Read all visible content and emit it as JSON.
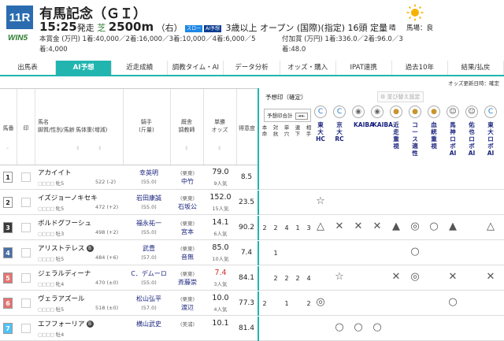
{
  "race": {
    "number": "11R",
    "name": "有馬記念（ＧＩ）",
    "win5": "WIN5",
    "start_time": "15:25",
    "start_suffix": "発走",
    "surface": "芝",
    "distance": "2500m",
    "direction": "（右）",
    "badge_slow": "スロー",
    "badge_yoso": "AI予想",
    "condition": "3歳以上 オープン (国際)(指定) 16頭 定量",
    "prize_line1": "本賞金 (万円) 1着:40,000／2着:16,000／3着:10,000／4着:6,000／5",
    "prize_line2": "着:4,000",
    "add_prize_line1": "付加賞 (万円) 1着:336.0／2着:96.0／3",
    "add_prize_line2": "着:48.0",
    "weather": "晴",
    "track_label": "馬場：良"
  },
  "tabs": [
    {
      "label": "出馬表",
      "active": false
    },
    {
      "label": "AI予想",
      "active": true
    },
    {
      "label": "近走成績",
      "active": false
    },
    {
      "label": "調教タイム・AI",
      "active": false
    },
    {
      "label": "データ分析",
      "active": false
    },
    {
      "label": "オッズ・購入",
      "active": false
    },
    {
      "label": "IPAT連携",
      "active": false
    },
    {
      "label": "過去10年",
      "active": false
    },
    {
      "label": "結果/払戻",
      "active": false
    }
  ],
  "update_note": "オッズ更新日時：確定",
  "columns": {
    "umaban": "馬番",
    "mark": "印",
    "horse": "馬名",
    "horse_sub": "脚質/性別/馬齢",
    "weight": "馬体重(増減)",
    "jockey": "騎手",
    "jockey_sub": "(斤量)",
    "stable": "厩舎",
    "stable_sub": "調教師",
    "odds": "単勝",
    "odds_sub": "オッズ",
    "tokui": "得意度"
  },
  "yosou": {
    "title": "予想印（確定）",
    "sort_label": "並び替え設定",
    "gokei_label": "予想印合計",
    "count_headers": [
      "本命",
      "対抗",
      "単穴",
      "連下",
      "相手"
    ],
    "predictors": [
      "東大HC",
      "京大RC",
      "KAIBA",
      "KAIBA",
      "近走重視",
      "コース適性",
      "血統重視",
      "馬神ロボAI",
      "佑也ロボAI",
      "東大ロボAI"
    ],
    "predictor_icons": [
      "c-icon",
      "c-icon",
      "robot-icon",
      "robot-icon",
      "medal-icon",
      "medal-icon",
      "medal-icon",
      "avatar-icon",
      "avatar-icon",
      "c-icon"
    ]
  },
  "horses": [
    {
      "waku": "1",
      "umaban": "1",
      "name": "アカイイト",
      "blinker": false,
      "style": "牝5",
      "weight": "522 (-2)",
      "jockey": "幸英明",
      "jweight": "(55.0)",
      "area": "(栗東)",
      "trainer": "中竹",
      "odds": "79.0",
      "pop": "9人気",
      "tokui": "8.5",
      "counts": [
        "",
        "",
        "",
        "",
        ""
      ],
      "marks": [
        "",
        "",
        "",
        "",
        "",
        "",
        "",
        "",
        "",
        ""
      ]
    },
    {
      "waku": "2",
      "umaban": "2",
      "name": "イズジョーノキセキ",
      "blinker": false,
      "style": "牝5",
      "weight": "472 (+2)",
      "jockey": "岩田康誠",
      "jweight": "(55.0)",
      "area": "(栗東)",
      "trainer": "石坂公",
      "odds": "152.0",
      "pop": "15人気",
      "tokui": "23.5",
      "counts": [
        "",
        "",
        "",
        "",
        ""
      ],
      "marks": [
        "☆",
        "",
        "",
        "",
        "",
        "",
        "",
        "",
        "",
        ""
      ]
    },
    {
      "waku": "3",
      "umaban": "3",
      "name": "ボルドグフーシュ",
      "blinker": false,
      "style": "牡3",
      "weight": "498 (+2)",
      "jockey": "福永祐一",
      "jweight": "(55.0)",
      "area": "(栗東)",
      "trainer": "宮本",
      "odds": "14.1",
      "pop": "6人気",
      "tokui": "90.2",
      "counts": [
        "2",
        "2",
        "4",
        "1",
        "3"
      ],
      "marks": [
        "△",
        "✕",
        "✕",
        "✕",
        "▲",
        "◎",
        "○",
        "▲",
        "",
        "△"
      ]
    },
    {
      "waku": "4",
      "umaban": "4",
      "name": "アリストテレス",
      "blinker": true,
      "style": "牡5",
      "weight": "484 (+6)",
      "jockey": "武豊",
      "jweight": "(57.0)",
      "area": "(栗東)",
      "trainer": "音無",
      "odds": "85.0",
      "pop": "10人気",
      "tokui": "7.4",
      "counts": [
        "",
        "1",
        "",
        "",
        ""
      ],
      "marks": [
        "",
        "",
        "",
        "",
        "",
        "○",
        "",
        "",
        "",
        ""
      ]
    },
    {
      "waku": "5",
      "umaban": "5",
      "name": "ジェラルディーナ",
      "blinker": false,
      "style": "牝4",
      "weight": "470 (±0)",
      "jockey": "C．デムーロ",
      "jweight": "(55.0)",
      "area": "(栗東)",
      "trainer": "斉藤崇",
      "odds": "7.4",
      "pop": "3人気",
      "tokui": "84.1",
      "counts": [
        "",
        "2",
        "2",
        "2",
        "4"
      ],
      "marks": [
        "",
        "☆",
        "",
        "",
        "✕",
        "◎",
        "",
        "✕",
        "",
        "✕"
      ]
    },
    {
      "waku": "6",
      "umaban": "6",
      "name": "ヴェラアズール",
      "blinker": false,
      "style": "牡5",
      "weight": "518 (±0)",
      "jockey": "松山弘平",
      "jweight": "(57.0)",
      "area": "(栗東)",
      "trainer": "渡辺",
      "odds": "10.0",
      "pop": "4人気",
      "tokui": "77.3",
      "counts": [
        "2",
        "",
        "1",
        "",
        "2"
      ],
      "marks": [
        "◎",
        "",
        "",
        "",
        "",
        "",
        "",
        "○",
        "",
        ""
      ]
    },
    {
      "waku": "7",
      "umaban": "7",
      "name": "エフフォーリア",
      "blinker": true,
      "style": "牡4",
      "weight": "",
      "jockey": "横山武史",
      "jweight": "",
      "area": "(美浦)",
      "trainer": "",
      "odds": "10.1",
      "pop": "",
      "tokui": "81.4",
      "counts": [
        "",
        "",
        "",
        "",
        ""
      ],
      "marks": [
        "",
        "○",
        "○",
        "○",
        "",
        "",
        "",
        "",
        "",
        ""
      ]
    }
  ],
  "colors": {
    "accent": "#22b5b0",
    "waku": [
      "#ffffff",
      "#ffffff",
      "#3a3a3a",
      "#4a6fa5",
      "#e57373",
      "#e57373",
      "#4fc3f7"
    ],
    "waku_text": [
      "#222222",
      "#222222",
      "#ffffff",
      "#ffffff",
      "#ffffff",
      "#ffffff",
      "#ffffff"
    ],
    "odds_low": "#d32f2f"
  }
}
